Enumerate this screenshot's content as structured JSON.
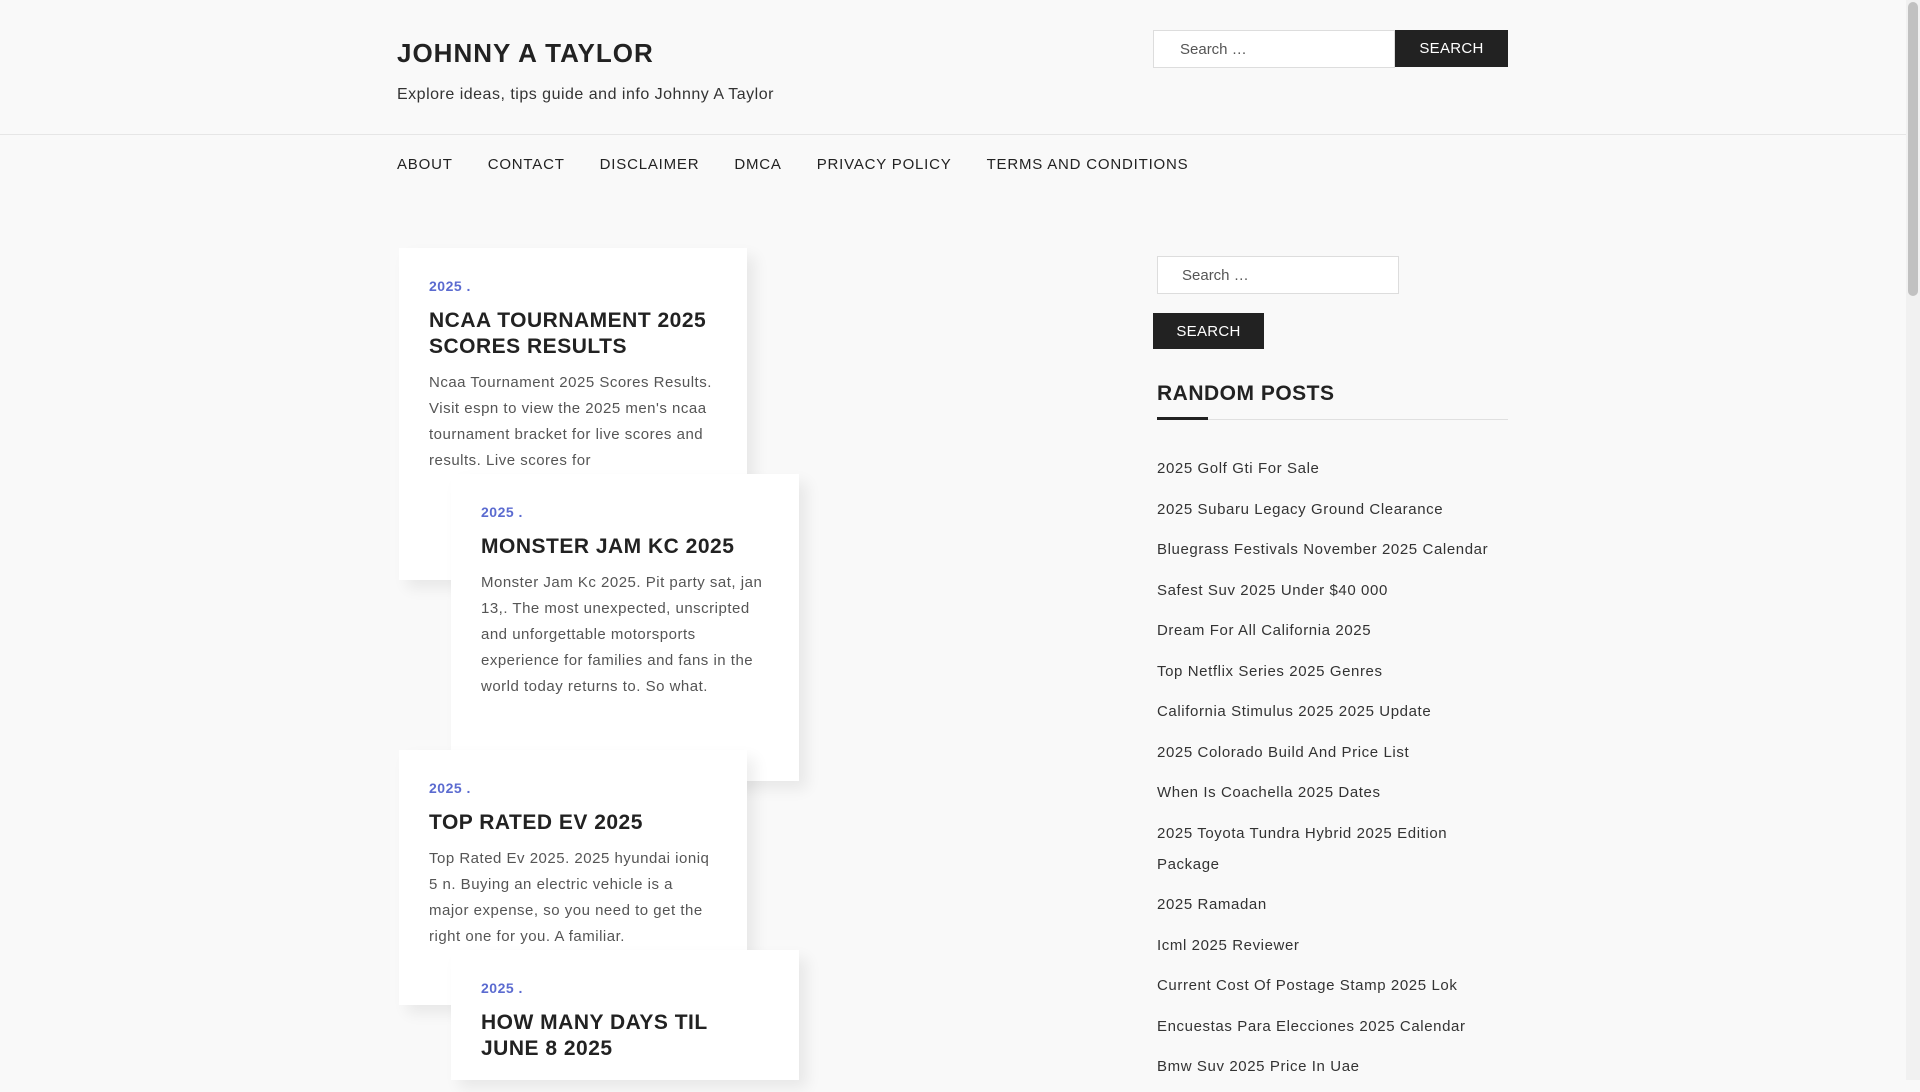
{
  "site": {
    "title": "JOHNNY A TAYLOR",
    "description": "Explore ideas, tips guide and info Johnny A Taylor"
  },
  "header_search": {
    "placeholder": "Search …",
    "button_label": "Search"
  },
  "nav": {
    "items": [
      {
        "label": "ABOUT"
      },
      {
        "label": "CONTACT"
      },
      {
        "label": "DISCLAIMER"
      },
      {
        "label": "DMCA"
      },
      {
        "label": "PRIVACY POLICY"
      },
      {
        "label": "TERMS AND CONDITIONS"
      }
    ]
  },
  "posts": [
    {
      "category": "2025",
      "title": "NCAA TOURNAMENT 2025 SCORES RESULTS",
      "excerpt": "Ncaa Tournament 2025 Scores Results. Visit espn to view the 2025 men's ncaa tournament bracket for live scores and results. Live scores for"
    },
    {
      "category": "2025",
      "title": "MONSTER JAM KC 2025",
      "excerpt": "Monster Jam Kc 2025. Pit party sat, jan 13,. The most unexpected, unscripted and unforgettable motorsports experience for families and fans in the world today returns to. So what."
    },
    {
      "category": "2025",
      "title": "TOP RATED EV 2025",
      "excerpt": "Top Rated Ev 2025. 2025 hyundai ioniq 5 n. Buying an electric vehicle is a major expense, so you need to get the right one for you. A familiar."
    },
    {
      "category": "2025",
      "title": "HOW MANY DAYS TIL JUNE 8 2025",
      "excerpt": ""
    }
  ],
  "sidebar": {
    "search": {
      "placeholder": "Search …",
      "button_label": "Search"
    },
    "random_posts": {
      "title": "RANDOM POSTS",
      "items": [
        "2025 Golf Gti For Sale",
        "2025 Subaru Legacy Ground Clearance",
        "Bluegrass Festivals November 2025 Calendar",
        "Safest Suv 2025 Under $40 000",
        "Dream For All California 2025",
        "Top Netflix Series 2025 Genres",
        "California Stimulus 2025 2025 Update",
        "2025 Colorado Build And Price List",
        "When Is Coachella 2025 Dates",
        "2025 Toyota Tundra Hybrid 2025 Edition Package",
        "2025 Ramadan",
        "Icml 2025 Reviewer",
        "Current Cost Of Postage Stamp 2025 Lok",
        "Encuestas Para Elecciones 2025 Calendar",
        "Bmw Suv 2025 Price In Uae"
      ]
    }
  },
  "colors": {
    "accent": "#5b6bd0",
    "button_bg": "#222222",
    "text": "#333333"
  }
}
